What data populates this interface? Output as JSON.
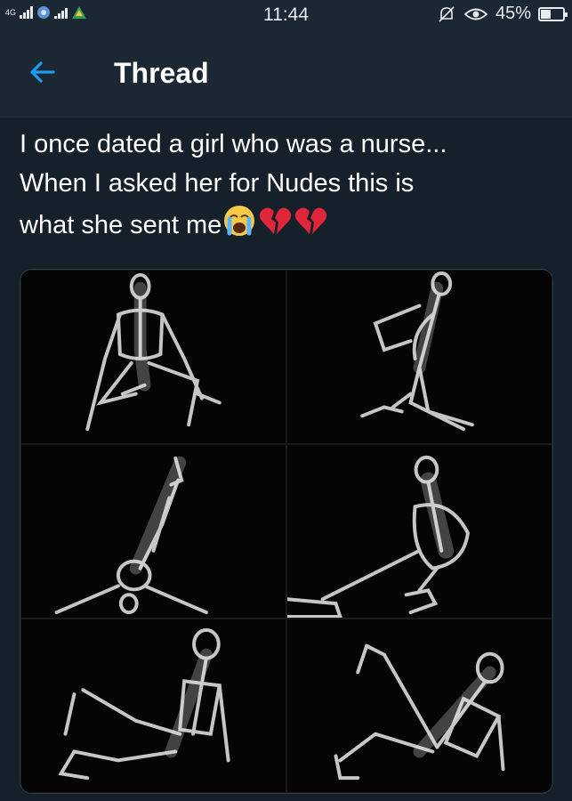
{
  "status_bar": {
    "network": "4G",
    "time": "11:44",
    "battery": "45%",
    "battery_level": 0.45
  },
  "header": {
    "back_icon": "arrow-left-icon",
    "title": "Thread"
  },
  "tweet": {
    "text_line1": "I once dated a girl who was a nurse...",
    "text_line2": "When I asked her for Nudes this is",
    "text_line3": "what she sent me",
    "emojis": [
      "crying-face-emoji",
      "broken-heart-emoji",
      "broken-heart-emoji"
    ]
  },
  "media": {
    "type": "x-ray image grid",
    "panels": 6
  },
  "colors": {
    "background": "#15202b",
    "accent": "#1d9bf0"
  }
}
